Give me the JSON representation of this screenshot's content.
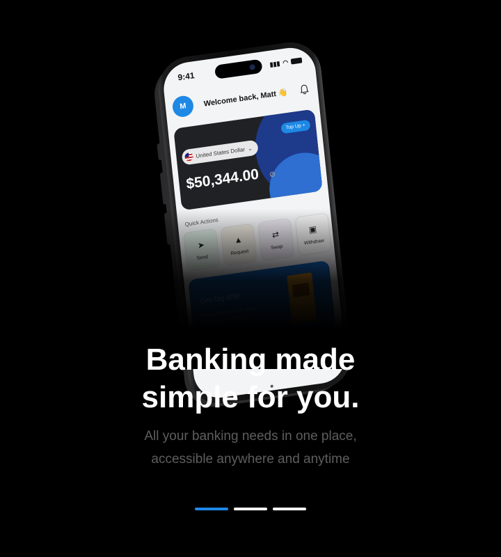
{
  "phone": {
    "status_time": "9:41",
    "avatar_initial": "M",
    "welcome": "Welcome back, Matt 👋",
    "top_up_label": "Top Up +",
    "currency_label": "United States Dollar",
    "balance": "$50,344.00",
    "quick_actions_label": "Quick Actions",
    "quick_actions": [
      {
        "label": "Send",
        "icon": "send-icon"
      },
      {
        "label": "Request",
        "icon": "request-icon"
      },
      {
        "label": "Swap",
        "icon": "swap-icon"
      },
      {
        "label": "Withdraw",
        "icon": "withdraw-icon"
      }
    ],
    "promo_title": "GeoTag ATM",
    "promo_sub": "View all Moth ATMs, up to 500 miles from you"
  },
  "onboarding": {
    "headline_line1": "Banking made",
    "headline_line2": "simple for you.",
    "subtitle_line1": "All your banking needs in one place,",
    "subtitle_line2": "accessible anywhere and anytime"
  },
  "pager": {
    "total": 3,
    "active_index": 0,
    "accent": "#1E88E5"
  }
}
